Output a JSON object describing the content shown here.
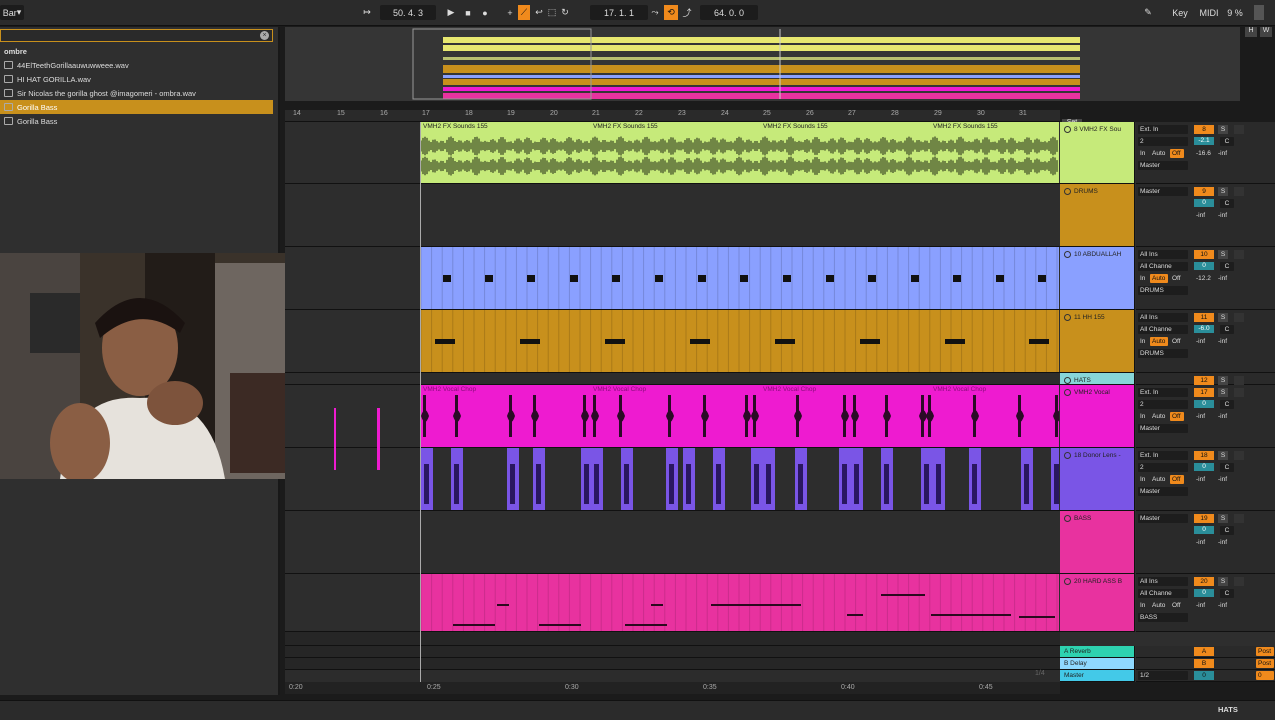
{
  "topbar": {
    "menu_label": "Bar",
    "arr_pos": "50. 4. 3",
    "loop_start": "17. 1. 1",
    "loop_len": "64. 0. 0",
    "key_label": "Key",
    "midi_label": "MIDI",
    "cpu": "9 %",
    "overview_h": "H",
    "overview_w": "W"
  },
  "browser": {
    "header": "ombre",
    "items": [
      "44ElTeethGorillaauwuwweee.wav",
      "HI HAT GORILLA.wav",
      "Sir Nicolas the gorilla ghost @imagomeri - ombra.wav",
      "Gorilla Bass",
      "Gorilla Bass"
    ],
    "selected_index": 3
  },
  "ruler": {
    "bars": [
      "14",
      "15",
      "16",
      "17",
      "18",
      "19",
      "20",
      "21",
      "22",
      "23",
      "24",
      "25",
      "26",
      "27",
      "28",
      "29",
      "30",
      "31"
    ],
    "set_label": "Set"
  },
  "clip_labels": {
    "fx": "VMH2 FX Sounds 155",
    "vocal": "VMH2 Vocal Chop"
  },
  "tracks": [
    {
      "name": "8 VMH2 FX Sou",
      "color": "#c6ea7a",
      "num": "8",
      "in": "Ext. In",
      "ch": "2",
      "vol": "-2.1",
      "pan": "C",
      "send": "-16.6",
      "send2": "-inf",
      "out": "Master"
    },
    {
      "name": "DRUMS",
      "color": "#c8901c",
      "num": "9",
      "in": "",
      "ch": "",
      "vol": "0",
      "pan": "C",
      "send": "-inf",
      "send2": "-inf",
      "out": "Master"
    },
    {
      "name": "10 ABDUALLAH",
      "color": "#8aa0ff",
      "num": "10",
      "in": "All Ins",
      "ch": "All Channe",
      "vol": "0",
      "pan": "C",
      "send": "-12.2",
      "send2": "-inf",
      "out": "DRUMS"
    },
    {
      "name": "11 HH 155",
      "color": "#c8901c",
      "num": "11",
      "in": "All Ins",
      "ch": "All Channe",
      "vol": "-6.0",
      "pan": "C",
      "send": "-inf",
      "send2": "-inf",
      "out": "DRUMS"
    },
    {
      "name": "HATS",
      "color": "#87d6d8",
      "num": "12",
      "in": "",
      "ch": "",
      "vol": "",
      "pan": "",
      "send": "",
      "send2": "",
      "out": ""
    },
    {
      "name": "VMH2 Vocal",
      "color": "#ee1bd0",
      "num": "17",
      "in": "Ext. In",
      "ch": "2",
      "vol": "0",
      "pan": "C",
      "send": "-inf",
      "send2": "-inf",
      "out": "Master"
    },
    {
      "name": "18 Donor Lens -",
      "color": "#7a55e6",
      "num": "18",
      "in": "Ext. In",
      "ch": "2",
      "vol": "0",
      "pan": "C",
      "send": "-inf",
      "send2": "-inf",
      "out": "Master"
    },
    {
      "name": "BASS",
      "color": "#e8329f",
      "num": "19",
      "in": "",
      "ch": "",
      "vol": "0",
      "pan": "C",
      "send": "-inf",
      "send2": "-inf",
      "out": "Master"
    },
    {
      "name": "20 HARD ASS B",
      "color": "#e8329f",
      "num": "20",
      "in": "All Ins",
      "ch": "All Channe",
      "vol": "0",
      "pan": "C",
      "send": "-inf",
      "send2": "-inf",
      "out": "BASS"
    }
  ],
  "returns": [
    {
      "name": "A Reverb",
      "color": "#2ed2b0",
      "num": "A",
      "post": "Post"
    },
    {
      "name": "B Delay",
      "color": "#8fd9ff",
      "num": "B",
      "post": "Post"
    },
    {
      "name": "Master",
      "color": "#43c9e8",
      "num": "0",
      "post": "0",
      "sel": "1/2"
    }
  ],
  "labels": {
    "in_label": "In",
    "auto_label": "Auto",
    "off_label": "Off",
    "s_label": "S",
    "zoom": "1/4"
  },
  "timeline": [
    "0:20",
    "0:25",
    "0:30",
    "0:35",
    "0:40",
    "0:45"
  ],
  "status": {
    "track_name": "HATS"
  },
  "colors": {
    "accent": "#f08a1c",
    "selected": "#c8901c"
  }
}
